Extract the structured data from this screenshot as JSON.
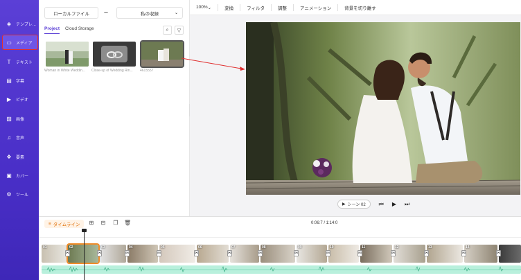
{
  "sidebar": {
    "items": [
      {
        "label": "テンプレ...",
        "icon": "layers-icon",
        "glyph": "◈"
      },
      {
        "label": "メディア",
        "icon": "folder-icon",
        "glyph": "▭"
      },
      {
        "label": "テキスト",
        "icon": "text-icon",
        "glyph": "T"
      },
      {
        "label": "字幕",
        "icon": "subtitle-icon",
        "glyph": "▤"
      },
      {
        "label": "ビデオ",
        "icon": "video-icon",
        "glyph": "▶"
      },
      {
        "label": "画像",
        "icon": "image-icon",
        "glyph": "▨"
      },
      {
        "label": "音声",
        "icon": "music-icon",
        "glyph": "♫"
      },
      {
        "label": "要素",
        "icon": "elements-icon",
        "glyph": "❖"
      },
      {
        "label": "カバー",
        "icon": "cover-icon",
        "glyph": "▣"
      },
      {
        "label": "ツール",
        "icon": "tools-icon",
        "glyph": "⚙"
      }
    ]
  },
  "panel": {
    "local_file": "ローカルファイル",
    "more": "•••",
    "my_storage": "私の収録",
    "tabs": [
      "Project",
      "Cloud Storage"
    ],
    "media": [
      {
        "caption": "Woman in White Weddin..."
      },
      {
        "caption": "Close-up of Wedding Rin..."
      },
      {
        "caption": "4615557"
      }
    ]
  },
  "toolbar": {
    "zoom": "100%",
    "items": [
      "変換",
      "フィルタ",
      "調整",
      "アニメーション",
      "背景を切り離す"
    ]
  },
  "player": {
    "scene": "シーン 02",
    "prev": "⏮",
    "play": "▶",
    "next": "⏭"
  },
  "timeline": {
    "label": "タイムライン",
    "time": "0:06:7 / 1:14:0",
    "clip_numbers": [
      "01",
      "02",
      "03",
      "04",
      "05",
      "06",
      "07",
      "08",
      "09",
      "10",
      "11",
      "12",
      "13",
      "14"
    ]
  },
  "colors": {
    "sidebar": "#4a2fc8",
    "accent": "#5b3fd6",
    "selected_clip": "#f08c2a",
    "audio_track": "#b8f0dc",
    "annotation_arrow": "#e03030"
  }
}
